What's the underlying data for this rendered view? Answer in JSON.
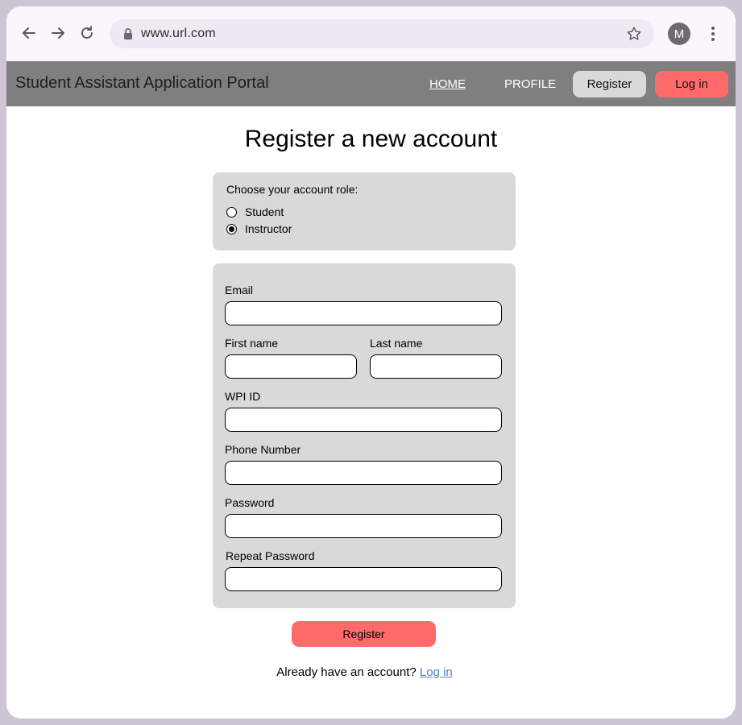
{
  "browser": {
    "url": "www.url.com",
    "avatar_initial": "M"
  },
  "appbar": {
    "brand": "Student Assistant Application Portal",
    "nav_home": "HOME",
    "nav_profile": "PROFILE",
    "register_label": "Register",
    "login_label": "Log in"
  },
  "page": {
    "title": "Register a new account"
  },
  "role": {
    "prompt": "Choose your account role:",
    "options": [
      {
        "label": "Student",
        "checked": false
      },
      {
        "label": "Instructor",
        "checked": true
      }
    ]
  },
  "form": {
    "email_label": "Email",
    "first_name_label": "First name",
    "last_name_label": "Last name",
    "wpi_id_label": "WPI ID",
    "phone_label": "Phone Number",
    "password_label": "Password",
    "repeat_password_label": "Repeat Password",
    "submit_label": "Register"
  },
  "footer": {
    "prompt": "Already have an account?",
    "login_link": "Log in"
  },
  "colors": {
    "accent": "#ff6b6b",
    "appbar": "#7f7f7f",
    "panel": "#d9d9d9",
    "link": "#4a86c5"
  }
}
